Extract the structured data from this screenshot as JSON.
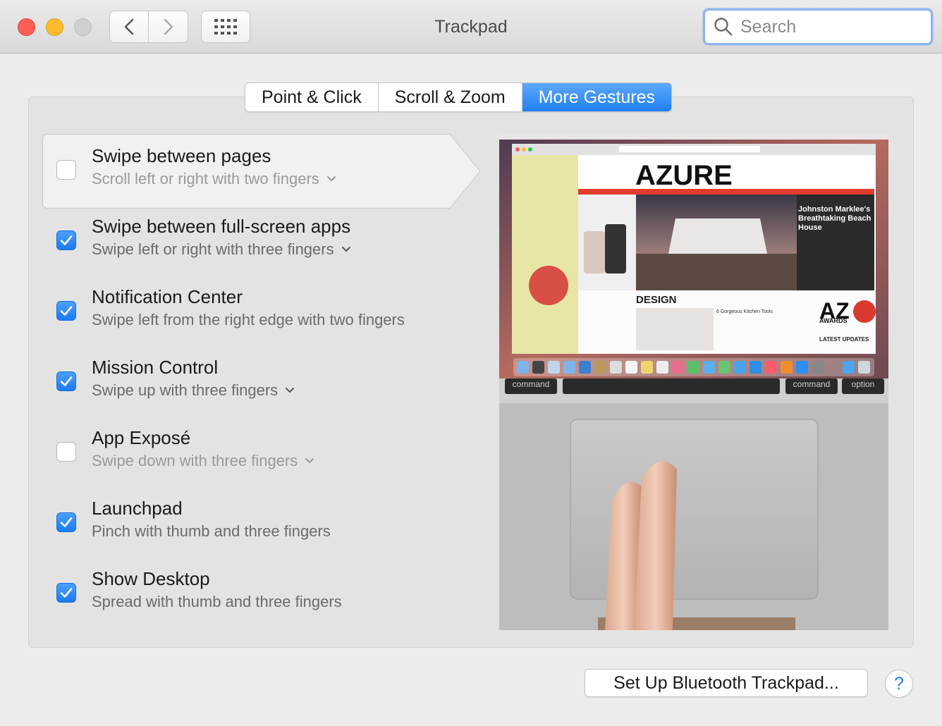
{
  "window": {
    "title": "Trackpad",
    "search_placeholder": "Search"
  },
  "tabs": [
    {
      "label": "Point & Click",
      "active": false
    },
    {
      "label": "Scroll & Zoom",
      "active": false
    },
    {
      "label": "More Gestures",
      "active": true
    }
  ],
  "gestures": [
    {
      "title": "Swipe between pages",
      "subtitle": "Scroll left or right with two fingers",
      "checked": false,
      "has_menu": true,
      "selected": true
    },
    {
      "title": "Swipe between full-screen apps",
      "subtitle": "Swipe left or right with three fingers",
      "checked": true,
      "has_menu": true,
      "selected": false
    },
    {
      "title": "Notification Center",
      "subtitle": "Swipe left from the right edge with two fingers",
      "checked": true,
      "has_menu": false,
      "selected": false
    },
    {
      "title": "Mission Control",
      "subtitle": "Swipe up with three fingers",
      "checked": true,
      "has_menu": true,
      "selected": false
    },
    {
      "title": "App Exposé",
      "subtitle": "Swipe down with three fingers",
      "checked": false,
      "has_menu": true,
      "selected": false
    },
    {
      "title": "Launchpad",
      "subtitle": "Pinch with thumb and three fingers",
      "checked": true,
      "has_menu": false,
      "selected": false
    },
    {
      "title": "Show Desktop",
      "subtitle": "Spread with thumb and three fingers",
      "checked": true,
      "has_menu": false,
      "selected": false
    }
  ],
  "preview": {
    "site_logo": "AZURE",
    "headline": "Johnston Marklee's Breathtaking Beach House",
    "section": "DESIGN",
    "article": "6 Gorgeous Kitchen Tools",
    "awards_logo": "AZ",
    "awards_sub": "AWARDS",
    "latest": "LATEST UPDATES",
    "key_left": "command",
    "key_right": "command",
    "key_option": "option"
  },
  "footer": {
    "bluetooth_button": "Set Up Bluetooth Trackpad...",
    "help_label": "?"
  },
  "colors": {
    "accent": "#1f7ff3",
    "close": "#fd5f57",
    "minimize": "#fdbb2e"
  }
}
